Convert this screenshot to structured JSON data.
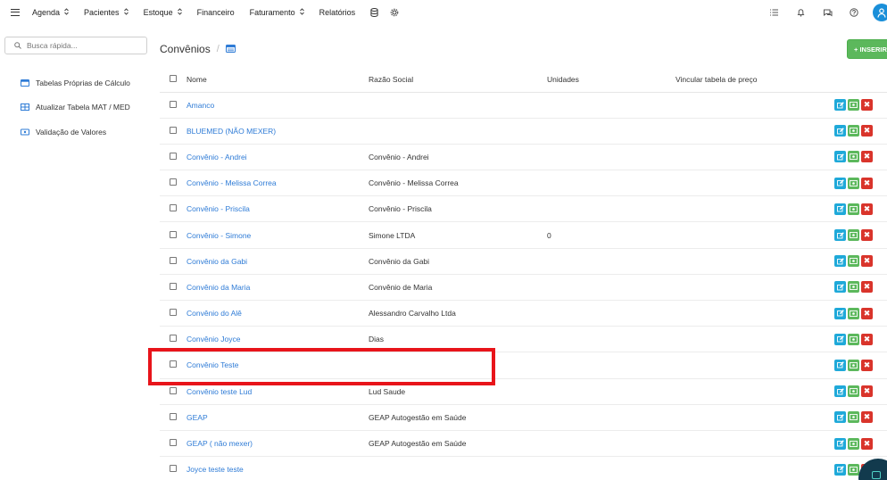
{
  "topnav": {
    "items": [
      {
        "label": "Agenda",
        "dropdown": true
      },
      {
        "label": "Pacientes",
        "dropdown": true
      },
      {
        "label": "Estoque",
        "dropdown": true
      },
      {
        "label": "Financeiro",
        "dropdown": false
      },
      {
        "label": "Faturamento",
        "dropdown": true
      },
      {
        "label": "Relatórios",
        "dropdown": false
      }
    ],
    "caret": "⌃⌄",
    "icons": [
      "menu-icon",
      "database-icon",
      "settings-icon",
      "list-icon",
      "bell-icon",
      "chat-icon",
      "help-icon",
      "user-icon"
    ]
  },
  "sidebar": {
    "search_placeholder": "Busca rápida...",
    "items": [
      {
        "label": "Tabelas Próprias de Cálculo",
        "icon": "table-icon"
      },
      {
        "label": "Atualizar Tabela MAT / MED",
        "icon": "grid-icon"
      },
      {
        "label": "Validação de Valores",
        "icon": "money-icon"
      }
    ]
  },
  "page": {
    "title": "Convênios",
    "breadcrumb_sep": "/",
    "insert_label": "+ INSERIR"
  },
  "table": {
    "columns": [
      "Nome",
      "Razão Social",
      "Unidades",
      "Vincular tabela de preço"
    ],
    "rows": [
      {
        "nome": "Amanco",
        "razao": "",
        "unidades": ""
      },
      {
        "nome": "BLUEMED (NÃO MEXER)",
        "razao": "",
        "unidades": ""
      },
      {
        "nome": "Convênio - Andrei",
        "razao": "Convênio - Andrei",
        "unidades": ""
      },
      {
        "nome": "Convênio - Melissa Correa",
        "razao": "Convênio - Melissa Correa",
        "unidades": ""
      },
      {
        "nome": "Convênio - Priscila",
        "razao": "Convênio - Priscila",
        "unidades": ""
      },
      {
        "nome": "Convênio - Simone",
        "razao": "Simone LTDA",
        "unidades": "0"
      },
      {
        "nome": "Convênio da Gabi",
        "razao": "Convênio da Gabi",
        "unidades": ""
      },
      {
        "nome": "Convênio da Maria",
        "razao": "Convênio de Maria",
        "unidades": ""
      },
      {
        "nome": "Convênio do Alê",
        "razao": "Alessandro Carvalho Ltda",
        "unidades": ""
      },
      {
        "nome": "Convênio Joyce",
        "razao": "Dias",
        "unidades": ""
      },
      {
        "nome": "Convênio Teste",
        "razao": "",
        "unidades": ""
      },
      {
        "nome": "Convênio teste Lud",
        "razao": "Lud Saude",
        "unidades": ""
      },
      {
        "nome": "GEAP",
        "razao": "GEAP Autogestão em Saúde",
        "unidades": ""
      },
      {
        "nome": "GEAP ( não mexer)",
        "razao": "GEAP Autogestão em Saúde",
        "unidades": ""
      },
      {
        "nome": "Joyce teste teste",
        "razao": "",
        "unidades": ""
      }
    ],
    "delete_glyph": "✖"
  },
  "colors": {
    "link": "#2e7bd6",
    "insert": "#5cb85c",
    "edit": "#1fa9d9",
    "delete": "#d9342b",
    "highlight": "#e8141a"
  }
}
